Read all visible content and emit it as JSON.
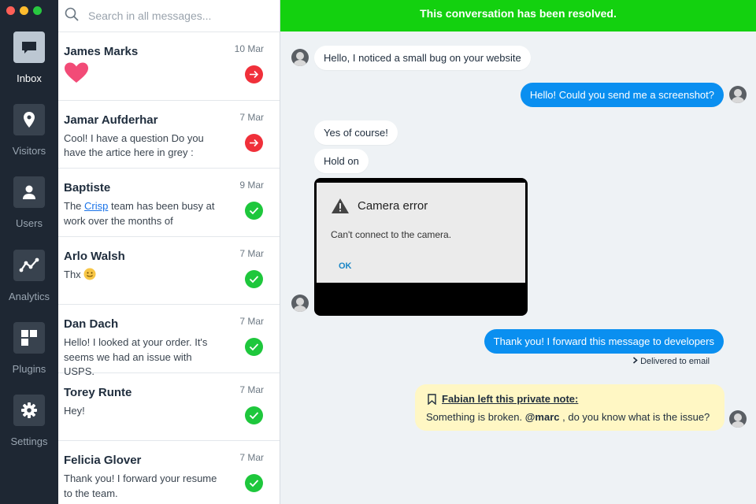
{
  "window": {
    "traffic_lights": [
      "#ff5f57",
      "#febc2e",
      "#28c840"
    ]
  },
  "sidebar": {
    "items": [
      {
        "label": "Inbox",
        "icon": "inbox-icon",
        "active": true
      },
      {
        "label": "Visitors",
        "icon": "location-pin-icon"
      },
      {
        "label": "Users",
        "icon": "user-icon"
      },
      {
        "label": "Analytics",
        "icon": "analytics-icon"
      },
      {
        "label": "Plugins",
        "icon": "plugins-icon"
      },
      {
        "label": "Settings",
        "icon": "gear-icon"
      }
    ]
  },
  "search": {
    "placeholder": "Search in all messages..."
  },
  "conversations": [
    {
      "name": "James Marks",
      "date": "10 Mar",
      "preview_emoji": "heart",
      "status": "pending"
    },
    {
      "name": "Jamar Aufderhar",
      "date": "7 Mar",
      "preview": "Cool! I have a question Do you have the artice here in grey :",
      "status": "pending"
    },
    {
      "name": "Baptiste",
      "date": "9 Mar",
      "preview_before": "The ",
      "preview_link": "Crisp",
      "preview_after": " team has been busy at work over the months of",
      "status": "resolved"
    },
    {
      "name": "Arlo Walsh",
      "date": "7 Mar",
      "preview": "Thx",
      "preview_emoji": "slightly-smiling-face",
      "status": "resolved"
    },
    {
      "name": "Dan Dach",
      "date": "7 Mar",
      "preview": "Hello! I looked at your order. It's seems we had an issue with USPS.",
      "status": "resolved"
    },
    {
      "name": "Torey Runte",
      "date": "7 Mar",
      "preview": "Hey!",
      "status": "resolved"
    },
    {
      "name": "Felicia Glover",
      "date": "7 Mar",
      "preview": "Thank you! I forward your resume to the team.",
      "status": "resolved"
    }
  ],
  "chat": {
    "banner": "This conversation has been resolved.",
    "messages": [
      {
        "from": "visitor",
        "text": "Hello, I noticed a small bug on your website"
      },
      {
        "from": "operator",
        "text": "Hello! Could you send me a screenshot?"
      },
      {
        "from": "visitor",
        "text": "Yes of course!"
      },
      {
        "from": "visitor",
        "text": "Hold on"
      },
      {
        "from": "operator",
        "text": "Thank you! I forward this message to developers"
      }
    ],
    "screenshot": {
      "title": "Camera error",
      "message": "Can't connect to the camera.",
      "button": "OK"
    },
    "delivered": "Delivered to email",
    "note": {
      "title": "Fabian left this private note:",
      "text_before": "Something is broken. ",
      "mention": "@marc",
      "text_after": " , do you know what is the issue?"
    },
    "colors": {
      "banner": "#13d10f",
      "operator_bubble": "#0a8ff0",
      "note_bg": "#fff7c4"
    }
  }
}
